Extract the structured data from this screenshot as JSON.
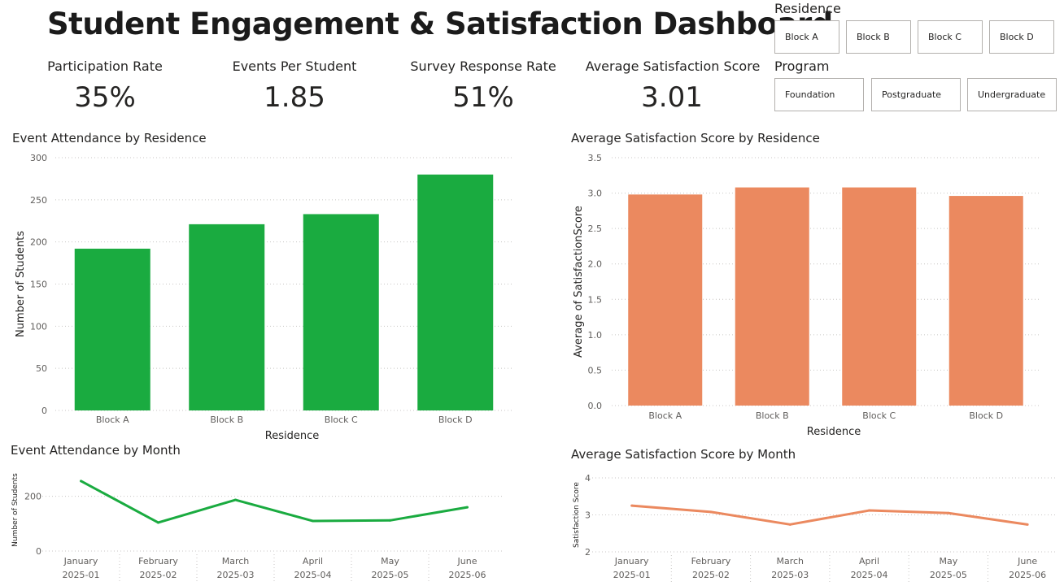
{
  "dashboard": {
    "title": "Student Engagement & Satisfaction Dashboard"
  },
  "kpis": [
    {
      "label": "Participation Rate",
      "value": "35%"
    },
    {
      "label": "Events Per Student",
      "value": "1.85"
    },
    {
      "label": "Survey Response Rate",
      "value": "51%"
    },
    {
      "label": "Average Satisfaction Score",
      "value": "3.01"
    }
  ],
  "slicers": {
    "residence": {
      "title": "Residence",
      "options": [
        "Block A",
        "Block B",
        "Block C",
        "Block D"
      ]
    },
    "program": {
      "title": "Program",
      "options": [
        "Foundation",
        "Postgraduate",
        "Undergraduate"
      ]
    }
  },
  "colors": {
    "green": "#1aab40",
    "orange": "#eb895f",
    "grid": "#c8c6c4",
    "text": "#605e5c"
  },
  "chart_data": [
    {
      "id": "attendance_by_residence",
      "type": "bar",
      "title": "Event Attendance by Residence",
      "xlabel": "Residence",
      "ylabel": "Number of Students",
      "categories": [
        "Block A",
        "Block B",
        "Block C",
        "Block D"
      ],
      "values": [
        192,
        221,
        233,
        280
      ],
      "yticks": [
        "0",
        "50",
        "100",
        "150",
        "200",
        "250",
        "300"
      ],
      "ylim": [
        0,
        300
      ],
      "color": "#1aab40",
      "grid": true
    },
    {
      "id": "satisfaction_by_residence",
      "type": "bar",
      "title": "Average Satisfaction Score by Residence",
      "xlabel": "Residence",
      "ylabel": "Average of SatisfactionScore",
      "categories": [
        "Block A",
        "Block B",
        "Block C",
        "Block D"
      ],
      "values": [
        2.98,
        3.08,
        3.08,
        2.96
      ],
      "yticks": [
        "0.0",
        "0.5",
        "1.0",
        "1.5",
        "2.0",
        "2.5",
        "3.0",
        "3.5"
      ],
      "ylim": [
        0,
        3.5
      ],
      "color": "#eb895f",
      "grid": true
    },
    {
      "id": "attendance_by_month",
      "type": "line",
      "title": "Event Attendance by Month",
      "ylabel": "Number of Students",
      "categories": [
        [
          "January",
          "2025-01"
        ],
        [
          "February",
          "2025-02"
        ],
        [
          "March",
          "2025-03"
        ],
        [
          "April",
          "2025-04"
        ],
        [
          "May",
          "2025-05"
        ],
        [
          "June",
          "2025-06"
        ]
      ],
      "values": [
        256,
        104,
        187,
        110,
        112,
        160
      ],
      "yticks": [
        "0",
        "200"
      ],
      "ylim": [
        0,
        300
      ],
      "color": "#1aab40",
      "grid": true
    },
    {
      "id": "satisfaction_by_month",
      "type": "line",
      "title": "Average Satisfaction Score by Month",
      "ylabel": "Satisfaction Score",
      "categories": [
        [
          "January",
          "2025-01"
        ],
        [
          "February",
          "2025-02"
        ],
        [
          "March",
          "2025-03"
        ],
        [
          "April",
          "2025-04"
        ],
        [
          "May",
          "2025-05"
        ],
        [
          "June",
          "2025-06"
        ]
      ],
      "values": [
        3.25,
        3.08,
        2.74,
        3.12,
        3.05,
        2.74
      ],
      "yticks": [
        "2",
        "3",
        "4"
      ],
      "ylim": [
        2,
        4
      ],
      "color": "#eb895f",
      "grid": true
    }
  ]
}
